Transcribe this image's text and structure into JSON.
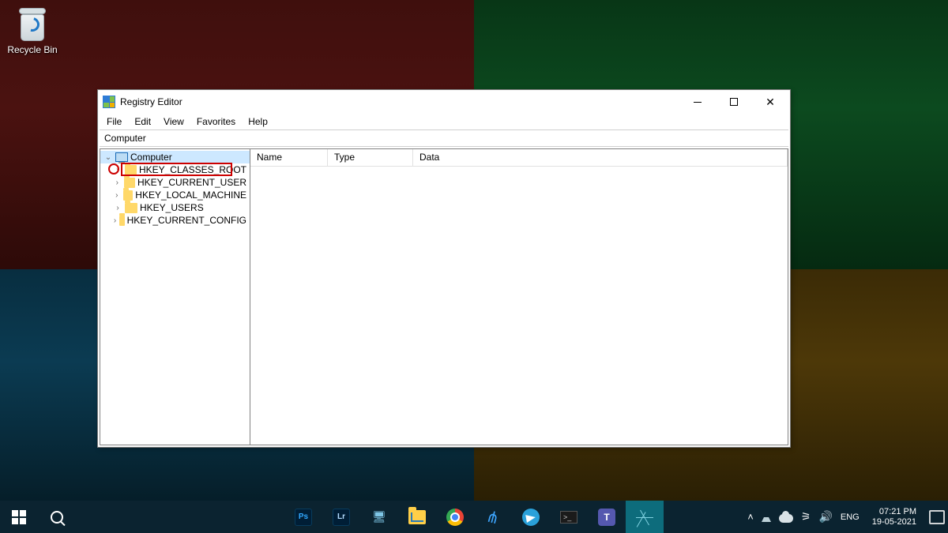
{
  "desktop": {
    "recycle_bin_label": "Recycle Bin"
  },
  "window": {
    "title": "Registry Editor",
    "menus": {
      "file": "File",
      "edit": "Edit",
      "view": "View",
      "favorites": "Favorites",
      "help": "Help"
    },
    "address": "Computer",
    "tree": {
      "root": "Computer",
      "keys": [
        "HKEY_CLASSES_ROOT",
        "HKEY_CURRENT_USER",
        "HKEY_LOCAL_MACHINE",
        "HKEY_USERS",
        "HKEY_CURRENT_CONFIG"
      ]
    },
    "columns": {
      "name": "Name",
      "type": "Type",
      "data": "Data"
    }
  },
  "taskbar": {
    "apps": {
      "ps": "Ps",
      "lr": "Lr"
    },
    "lang": "ENG",
    "time": "07:21 PM",
    "date": "19-05-2021"
  }
}
